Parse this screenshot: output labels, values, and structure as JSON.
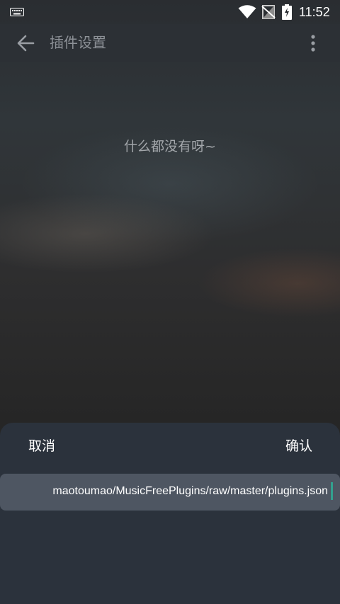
{
  "status_bar": {
    "time": "11:52",
    "icons": [
      "keyboard-icon",
      "wifi-icon",
      "no-signal-icon",
      "battery-charging-icon"
    ]
  },
  "app_bar": {
    "title": "插件设置",
    "back_icon": "arrow-left-icon",
    "more_icon": "more-vertical-icon"
  },
  "main": {
    "empty_message": "什么都没有呀~"
  },
  "sheet": {
    "cancel_label": "取消",
    "confirm_label": "确认",
    "input_value": "maotoumao/MusicFreePlugins/raw/master/plugins.json"
  },
  "colors": {
    "accent": "#33a08e",
    "sheet_bg": "#2b323c",
    "input_bg": "#4e5662",
    "app_bar_bg": "#2c3035"
  }
}
